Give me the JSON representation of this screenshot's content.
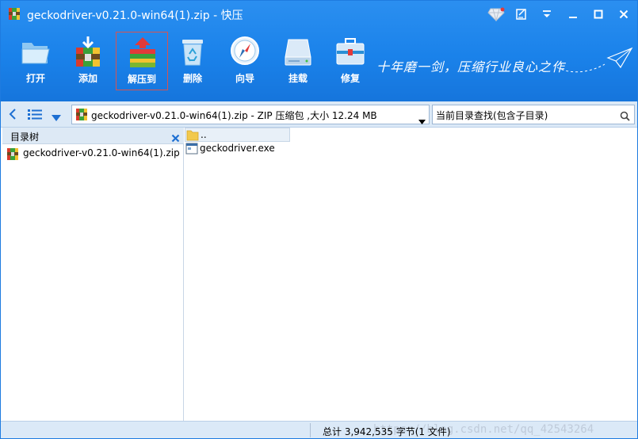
{
  "window": {
    "title": "geckodriver-v0.21.0-win64(1).zip - 快压"
  },
  "toolbar": {
    "buttons": [
      {
        "label": "打开",
        "icon": "folder-open-icon"
      },
      {
        "label": "添加",
        "icon": "add-archive-icon"
      },
      {
        "label": "解压到",
        "icon": "extract-archive-icon"
      },
      {
        "label": "删除",
        "icon": "recycle-bin-icon"
      },
      {
        "label": "向导",
        "icon": "compass-icon"
      },
      {
        "label": "挂载",
        "icon": "drive-icon"
      },
      {
        "label": "修复",
        "icon": "toolbox-icon"
      }
    ],
    "active_button": "解压到",
    "slogan": "十年磨一剑，压缩行业良心之作"
  },
  "address": {
    "path": "geckodriver-v0.21.0-win64(1).zip - ZIP 压缩包 ,大小 12.24 MB",
    "search_placeholder": "当前目录查找(包含子目录)"
  },
  "tree": {
    "title": "目录树",
    "items": [
      {
        "label": "geckodriver-v0.21.0-win64(1).zip"
      }
    ]
  },
  "files": {
    "items": [
      {
        "label": "..",
        "type": "parent-folder"
      },
      {
        "label": "geckodriver.exe",
        "type": "executable"
      }
    ]
  },
  "status": {
    "summary": "总计  3,942,535 字节(1 文件)",
    "watermark": "https://blog.csdn.net/qq_42543264"
  },
  "colors": {
    "toolbar_blue": "#1a82ea",
    "panel_blue": "#dbe9f7",
    "active_border": "#d9534f"
  }
}
